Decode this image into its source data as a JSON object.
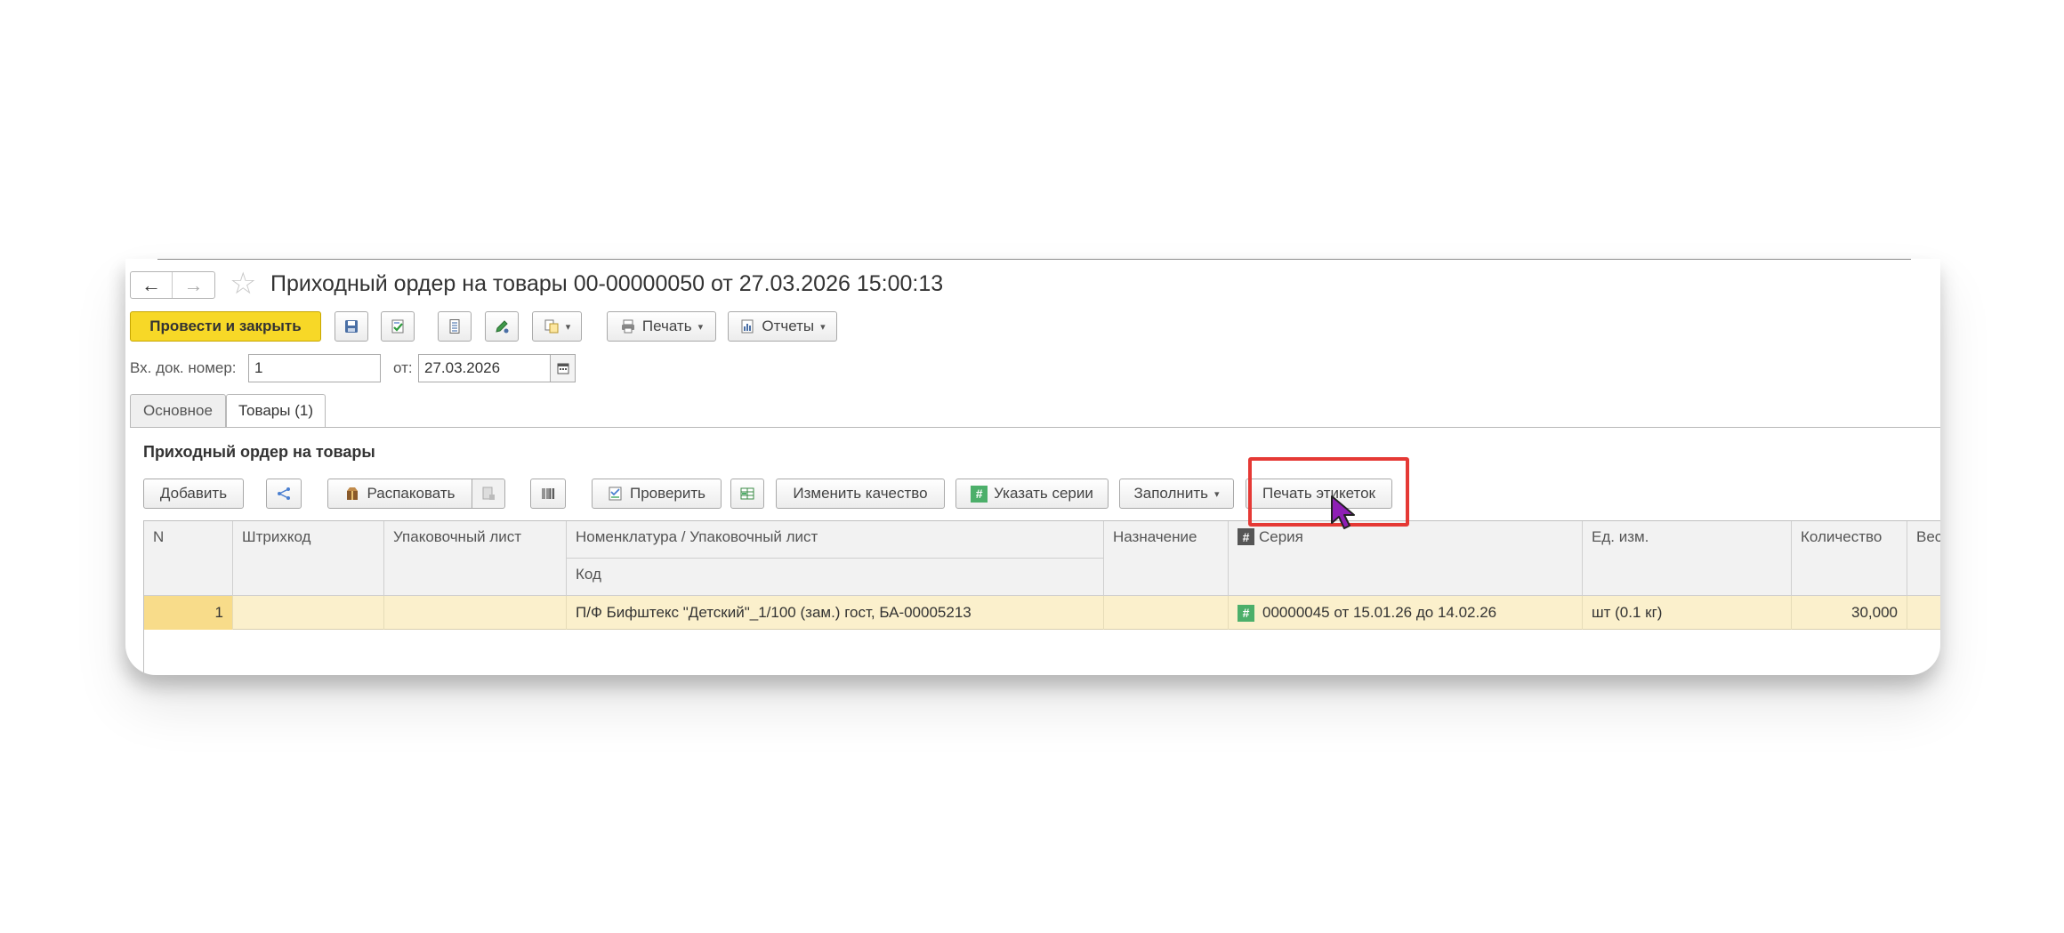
{
  "window": {
    "title": "Приходный ордер на товары 00-00000050 от 27.03.2026 15:00:13"
  },
  "toolbar": {
    "post_and_close": "Провести и закрыть",
    "print": "Печать",
    "reports": "Отчеты"
  },
  "header_fields": {
    "incoming_doc_label": "Вх. док. номер:",
    "incoming_doc_value": "1",
    "date_label": "от:",
    "date_value": "27.03.2026"
  },
  "tabs": [
    {
      "label": "Основное",
      "active": false
    },
    {
      "label": "Товары (1)",
      "active": true
    }
  ],
  "section": {
    "title": "Приходный ордер на товары"
  },
  "table_toolbar": {
    "add": "Добавить",
    "unpack": "Распаковать",
    "check": "Проверить",
    "change_quality": "Изменить качество",
    "specify_series": "Указать серии",
    "fill": "Заполнить",
    "print_labels": "Печать этикеток"
  },
  "table": {
    "columns": {
      "n": "N",
      "barcode": "Штрихкод",
      "packing_list": "Упаковочный лист",
      "nomenclature": "Номенклатура / Упаковочный лист",
      "code": "Код",
      "purpose": "Назначение",
      "series": "Серия",
      "unit": "Ед. изм.",
      "quantity": "Количество",
      "weight": "Вес"
    },
    "rows": [
      {
        "n": "1",
        "barcode": "",
        "packing_list": "",
        "nomenclature": "П/Ф Бифштекс \"Детский\"_1/100 (зам.) гост, БА-00005213",
        "purpose": "",
        "series": "00000045 от 15.01.26 до 14.02.26",
        "unit": "шт (0.1 кг)",
        "quantity": "30,000"
      }
    ]
  },
  "colors": {
    "accent_yellow": "#f7d827",
    "row_highlight": "#fbf0cc",
    "series_icon": "#4caf6a",
    "header_series_icon": "#555555",
    "callout_red": "#e53935"
  }
}
